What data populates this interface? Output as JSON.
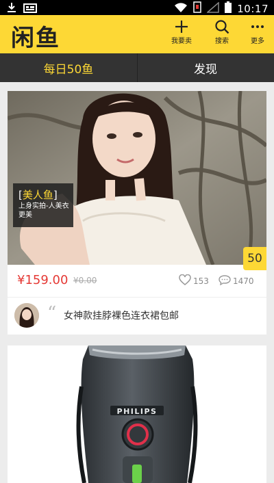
{
  "status_bar": {
    "time": "10:17"
  },
  "app_bar": {
    "logo": "闲鱼",
    "actions": [
      {
        "label": "我要卖",
        "icon": "plus-icon"
      },
      {
        "label": "搜索",
        "icon": "search-icon"
      },
      {
        "label": "更多",
        "icon": "more-icon"
      }
    ]
  },
  "tabs": [
    {
      "label": "每日50鱼",
      "active": true
    },
    {
      "label": "发现",
      "active": false
    }
  ],
  "feed": {
    "card1": {
      "tag_title": "美人鱼",
      "tag_subtitle": "上身实拍-人美衣更美",
      "badge": "50",
      "price": "¥159.00",
      "original_price": "¥0.00",
      "likes": "153",
      "comments": "1470",
      "description": "女神款挂脖裸色连衣裙包邮"
    },
    "card2": {
      "brand": "PHILIPS"
    }
  },
  "colors": {
    "accent": "#fdd835",
    "price": "#e53935",
    "tabbar": "#333333"
  }
}
